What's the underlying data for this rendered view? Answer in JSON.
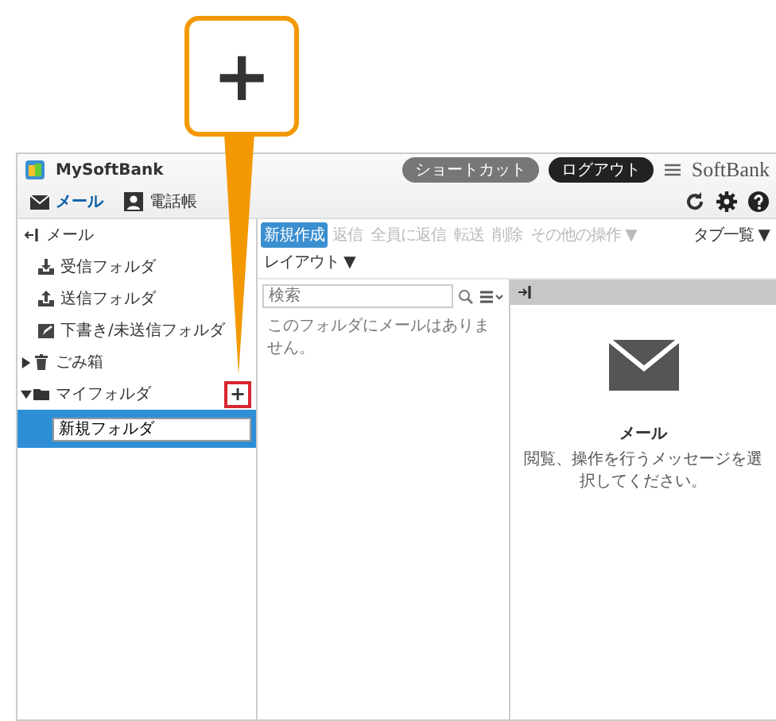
{
  "callout": {
    "symbol": "+"
  },
  "app": {
    "title": "MySoftBank",
    "header_buttons": [
      "ショートカット",
      "ログアウト"
    ],
    "brand": "SoftBank"
  },
  "nav_tabs": [
    {
      "label": "メール",
      "kind": "mail",
      "selected": true
    },
    {
      "label": "電話帳",
      "kind": "contacts",
      "selected": false
    }
  ],
  "sidebar": {
    "title": "メール",
    "items": [
      {
        "label": "受信フォルダ",
        "kind": "inbox"
      },
      {
        "label": "送信フォルダ",
        "kind": "sent"
      },
      {
        "label": "下書き/未送信フォルダ",
        "kind": "draft"
      },
      {
        "label": "ごみ箱",
        "kind": "trash",
        "expanded": false
      },
      {
        "label": "マイフォルダ",
        "kind": "folder",
        "expanded": true,
        "add_button": "+",
        "children": [
          {
            "label": "新規フォルダ",
            "kind": "input",
            "selected": true
          }
        ]
      }
    ]
  },
  "toolbar": [
    {
      "label": "新規作成",
      "disabled": false
    },
    {
      "label": "返信",
      "disabled": true
    },
    {
      "label": "全員に返信",
      "disabled": true
    },
    {
      "label": "転送",
      "disabled": true
    },
    {
      "label": "削除",
      "disabled": true
    },
    {
      "label": "その他の操作 ▼",
      "disabled": true
    }
  ],
  "toolbar_right": [
    "タブ一覧 ▼",
    "レイアウト ▼"
  ],
  "message_list": {
    "search": {
      "placeholder": "検索"
    },
    "empty_text": "このフォルダにメールはありません。"
  },
  "reader": {
    "title": "メール",
    "message": "閲覧、操作を行うメッセージを選択してください。"
  }
}
